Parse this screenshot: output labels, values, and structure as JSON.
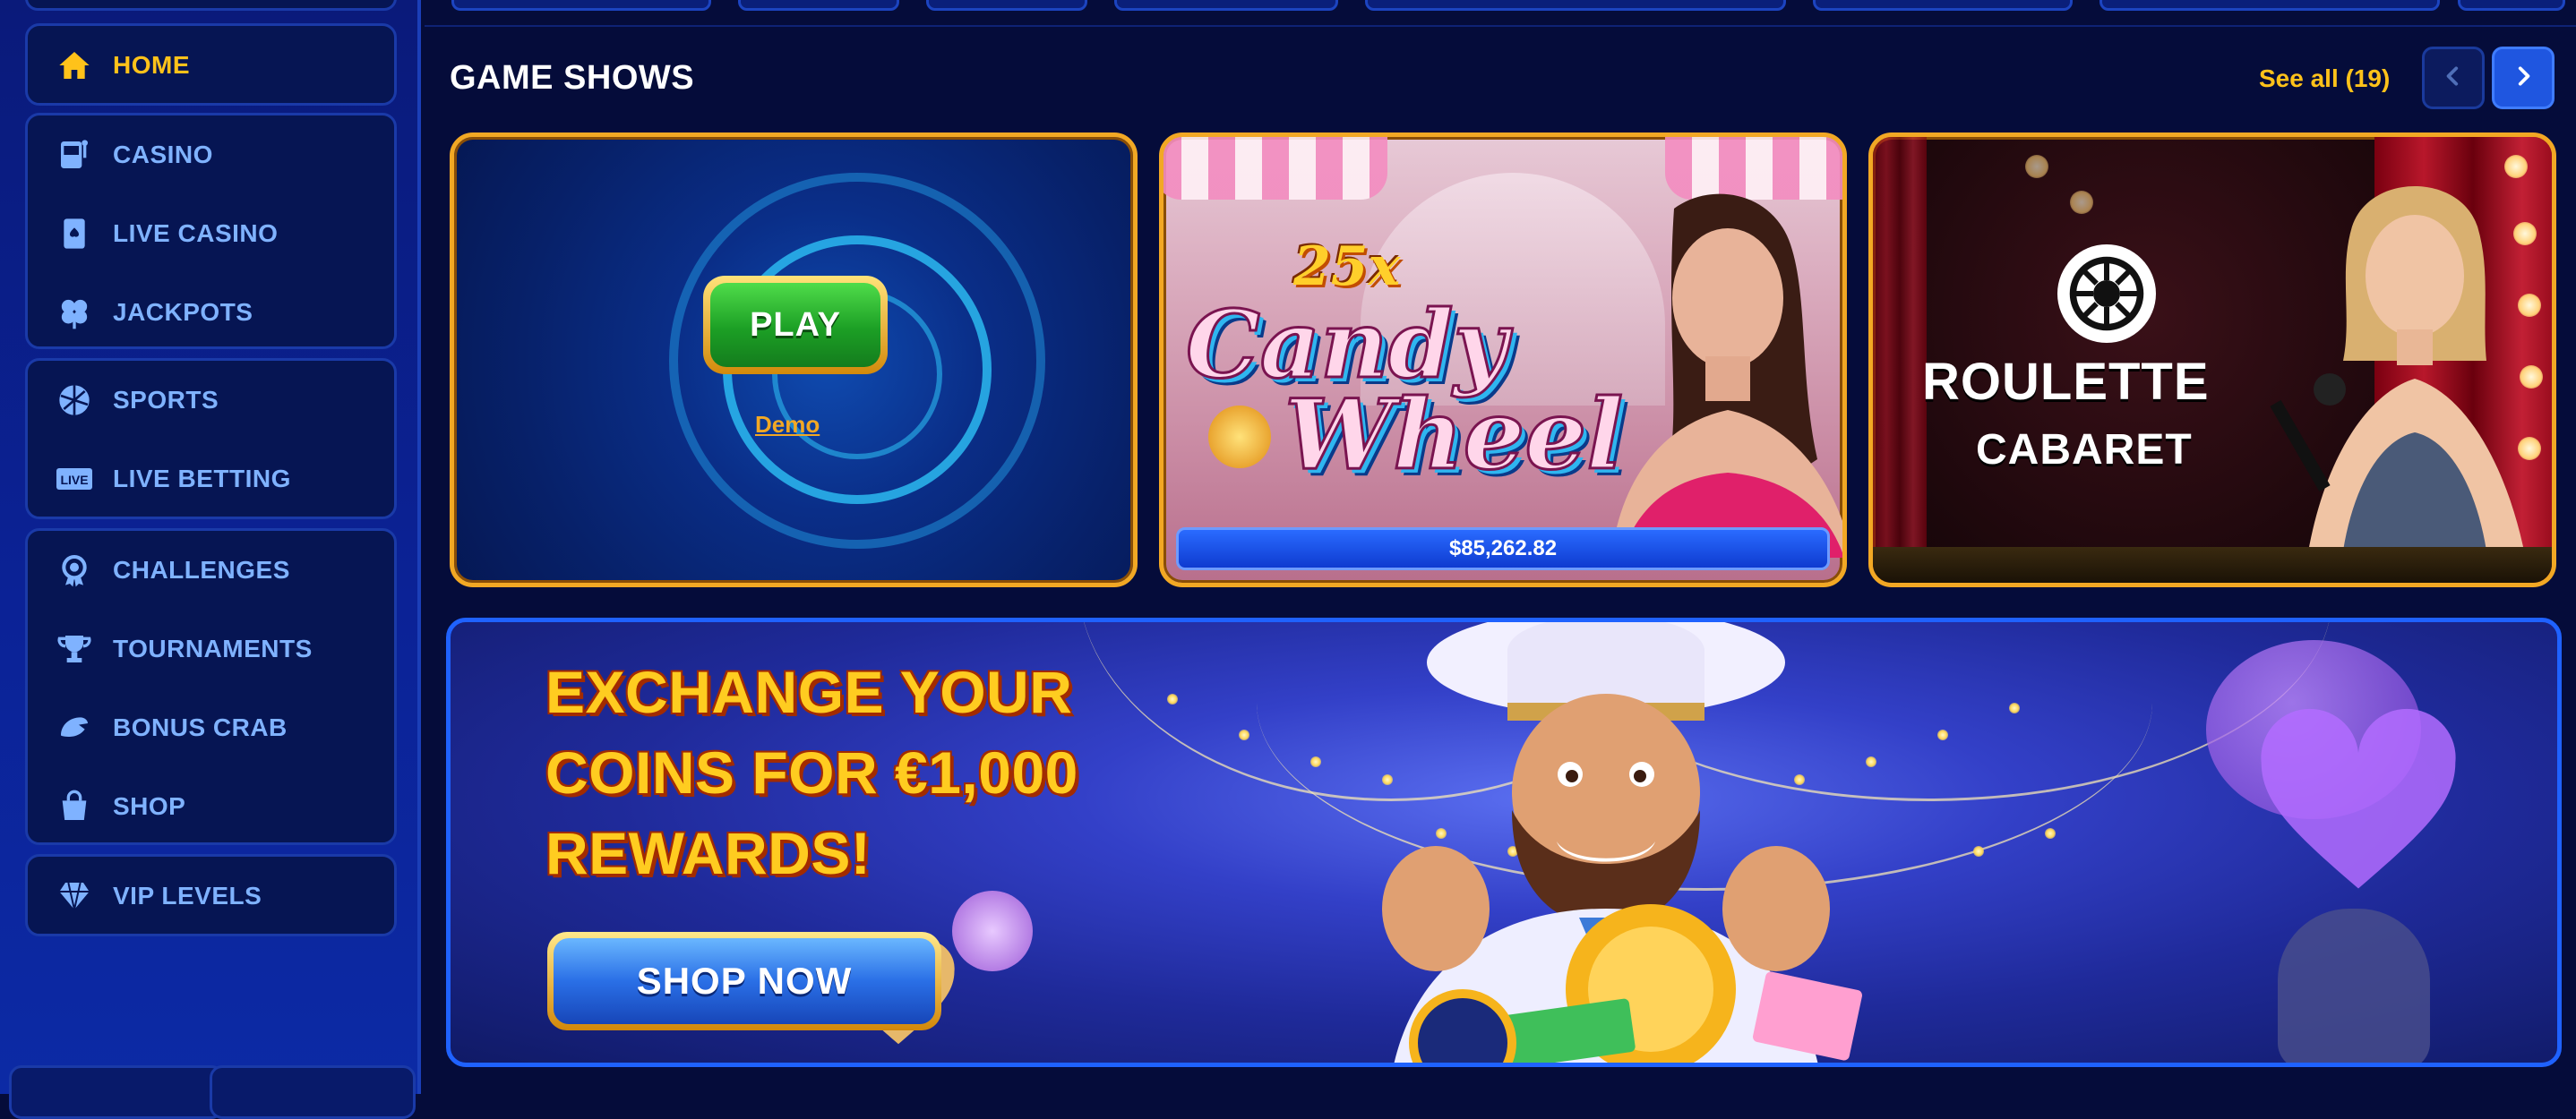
{
  "sidebar": {
    "groups": [
      {
        "items": [
          {
            "label": "HOME",
            "icon": "home-icon",
            "active": true
          }
        ]
      },
      {
        "items": [
          {
            "label": "CASINO",
            "icon": "slot-machine-icon"
          },
          {
            "label": "LIVE CASINO",
            "icon": "playing-card-icon"
          },
          {
            "label": "JACKPOTS",
            "icon": "clover-icon"
          }
        ]
      },
      {
        "items": [
          {
            "label": "SPORTS",
            "icon": "ball-icon"
          },
          {
            "label": "LIVE BETTING",
            "icon": "live-badge-icon",
            "badge": "LIVE"
          }
        ]
      },
      {
        "items": [
          {
            "label": "CHALLENGES",
            "icon": "medal-icon"
          },
          {
            "label": "TOURNAMENTS",
            "icon": "trophy-icon"
          },
          {
            "label": "BONUS CRAB",
            "icon": "crab-claw-icon"
          },
          {
            "label": "SHOP",
            "icon": "shopping-bag-icon"
          }
        ]
      },
      {
        "items": [
          {
            "label": "VIP LEVELS",
            "icon": "diamond-icon"
          }
        ]
      }
    ]
  },
  "section": {
    "title": "GAME SHOWS",
    "see_all": "See all (19)"
  },
  "cards": [
    {
      "play_label": "PLAY",
      "demo_label": "Demo"
    },
    {
      "logo_top": "25x",
      "logo_word1": "Candy",
      "logo_word2": "Wheel",
      "jackpot": "$85,262.82"
    },
    {
      "title": "ROULETTE",
      "subtitle": "CABARET"
    }
  ],
  "promo": {
    "line1": "EXCHANGE YOUR",
    "line2": "COINS FOR €1,000",
    "line3": "REWARDS!",
    "button": "SHOP NOW"
  },
  "colors": {
    "accent_gold": "#ffc21a",
    "nav_text": "#7fb2ff",
    "card_border": "#f2a824",
    "primary_blue": "#1f56e0"
  }
}
